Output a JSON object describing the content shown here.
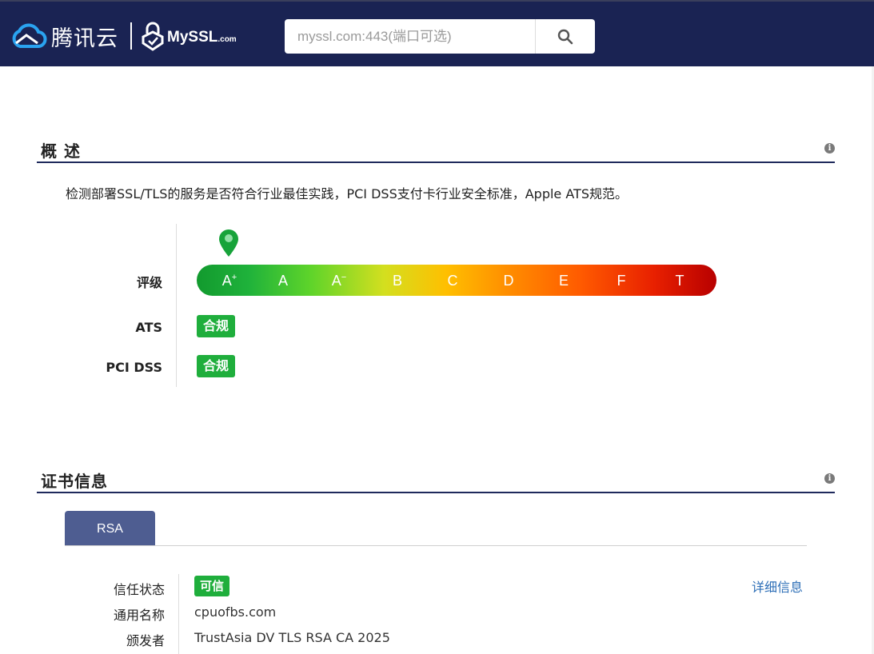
{
  "header": {
    "brand_tencent": "腾讯云",
    "brand_myssl": "MySSL",
    "brand_myssl_suffix": ".com",
    "search_placeholder": "myssl.com:443(端口可选)",
    "search_icon": "search-icon"
  },
  "overview": {
    "title": "概 述",
    "description": "检测部署SSL/TLS的服务是否符合行业最佳实践，PCI DSS支付卡行业安全标准，Apple ATS规范。",
    "grade_label": "评级",
    "grades": [
      "A",
      "A",
      "A",
      "B",
      "C",
      "D",
      "E",
      "F",
      "T"
    ],
    "grade_modifiers": [
      "+",
      "",
      "−",
      "",
      "",
      "",
      "",
      "",
      ""
    ],
    "current_grade_index": 0,
    "ats_label": "ATS",
    "ats_status": "合规",
    "pci_label": "PCI DSS",
    "pci_status": "合规"
  },
  "certificate": {
    "title": "证书信息",
    "tabs": [
      "RSA"
    ],
    "trust_label": "信任状态",
    "trust_value": "可信",
    "detail_link": "详细信息",
    "common_name_label": "通用名称",
    "common_name_value": "cpuofbs.com",
    "issuer_label": "颁发者",
    "issuer_value": "TrustAsia DV TLS RSA CA 2025"
  },
  "colors": {
    "header_bg": "#1a2353",
    "accent_green": "#1fae3c",
    "tab_blue": "#4e5d91",
    "link_blue": "#2e6fb7"
  }
}
